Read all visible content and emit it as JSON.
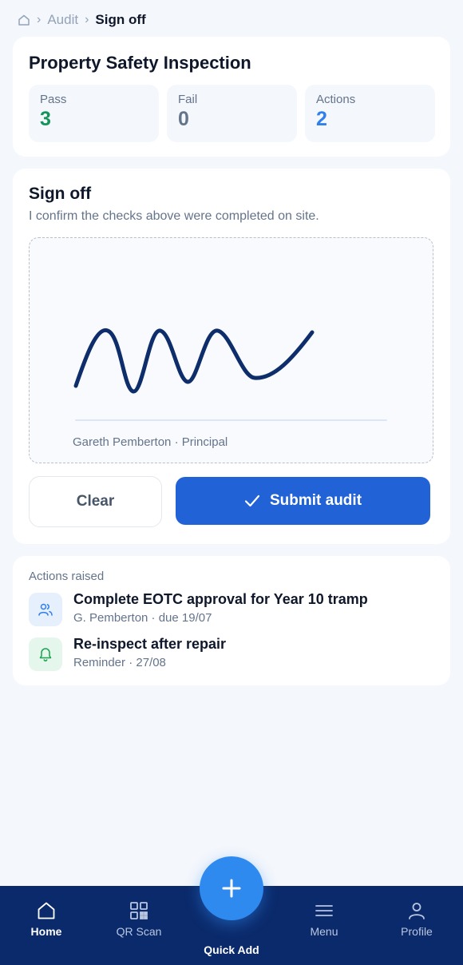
{
  "breadcrumb": {
    "home_icon": "home-icon",
    "items": [
      "Audit",
      "Sign off"
    ]
  },
  "summary": {
    "title": "Property Safety Inspection",
    "stats": [
      {
        "label": "Pass",
        "value": "3",
        "color": "#15935a"
      },
      {
        "label": "Fail",
        "value": "0",
        "color": "#64748b"
      },
      {
        "label": "Actions",
        "value": "2",
        "color": "#2f80ed"
      }
    ]
  },
  "signoff": {
    "title": "Sign off",
    "confirmation": "I confirm the checks above were completed on site.",
    "signer": "Gareth Pemberton · Principal",
    "ink_color": "#0e2d6b",
    "clear_label": "Clear",
    "submit_label": "Submit audit",
    "submit_color": "#2163d6"
  },
  "actions": {
    "heading": "Actions raised",
    "items": [
      {
        "title": "Complete EOTC approval for Year 10 tramp",
        "subtitle": "G. Pemberton · due 19/07",
        "icon": "people-icon"
      },
      {
        "title": "Re-inspect after repair",
        "subtitle": "Reminder · 27/08",
        "icon": "bell-icon"
      }
    ]
  },
  "nav": {
    "items": [
      {
        "label": "Home",
        "icon": "home-icon",
        "active": true
      },
      {
        "label": "QR Scan",
        "icon": "qr-icon"
      },
      {
        "label": "Menu",
        "icon": "menu-icon"
      },
      {
        "label": "Profile",
        "icon": "profile-icon"
      }
    ],
    "fab_label": "Quick Add",
    "fab_icon": "plus-icon",
    "background": "#0b2a6b"
  }
}
